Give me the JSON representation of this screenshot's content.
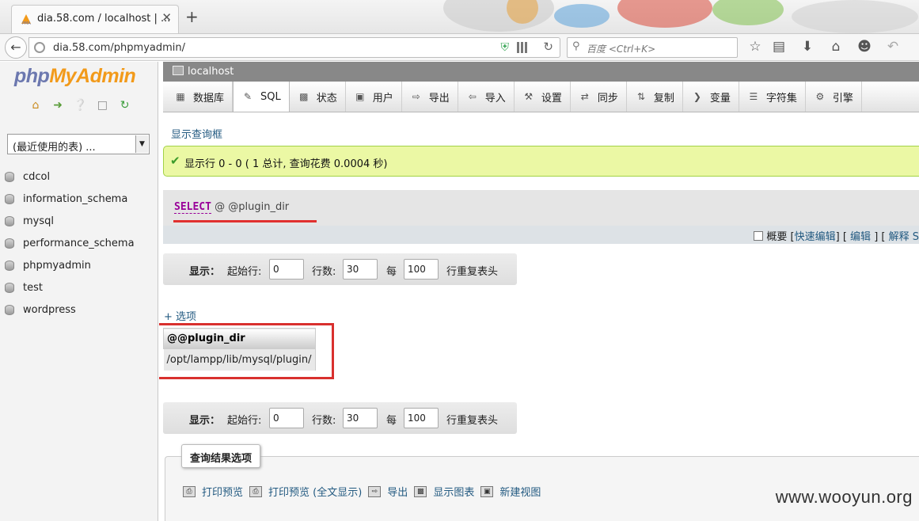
{
  "browser": {
    "tab_title": "dia.58.com / localhost | ...",
    "tab_close": "✕",
    "new_tab": "+",
    "url": "dia.58.com/phpmyadmin/",
    "search_placeholder": "百度 <Ctrl+K>"
  },
  "sidebar": {
    "logo_php": "php",
    "logo_myadmin": "MyAdmin",
    "recent_select": "(最近使用的表) ...",
    "databases": [
      "cdcol",
      "information_schema",
      "mysql",
      "performance_schema",
      "phpmyadmin",
      "test",
      "wordpress"
    ]
  },
  "server_bar": {
    "server": "localhost"
  },
  "menu": {
    "tabs": [
      "数据库",
      "SQL",
      "状态",
      "用户",
      "导出",
      "导入",
      "设置",
      "同步",
      "复制",
      "变量",
      "字符集",
      "引擎"
    ],
    "active": "SQL"
  },
  "show_query_link": "显示查询框",
  "success_message": "显示行 0 - 0 ( 1 总计, 查询花费 0.0004 秒)",
  "sql": {
    "keyword": "SELECT",
    "rest": " @ @plugin_dir"
  },
  "sql_links": {
    "profiling": "概要",
    "inline_edit": "快速编辑",
    "edit": "编辑",
    "explain": "解释 S"
  },
  "navigation": {
    "show_label": "显示：",
    "start_row_label": "起始行:",
    "start_row": "0",
    "rows_label": "行数:",
    "rows": "30",
    "per_label": "每",
    "repeat": "100",
    "repeat_suffix": "行重复表头"
  },
  "options_link": "+ 选项",
  "result": {
    "column": "@@plugin_dir",
    "value": "/opt/lampp/lib/mysql/plugin/"
  },
  "query_ops": {
    "legend": "查询结果选项",
    "ops": [
      "打印预览",
      "打印预览 (全文显示)",
      "导出",
      "显示图表",
      "新建视图"
    ]
  },
  "watermark": "www.wooyun.org",
  "colors": {
    "accent_link": "#235a81",
    "sql_keyword": "#990099",
    "success_bg": "#ebf8a4",
    "highlight": "#d9302e"
  }
}
